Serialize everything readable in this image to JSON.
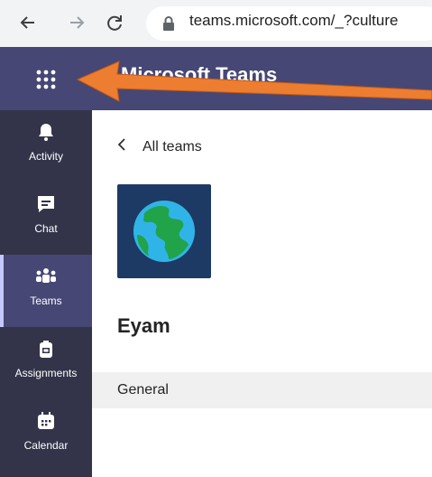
{
  "browser": {
    "url": "teams.microsoft.com/_?culture",
    "icons": [
      "back-arrow-icon",
      "forward-arrow-icon",
      "reload-icon",
      "lock-icon"
    ]
  },
  "header": {
    "app_title": "Microsoft Teams",
    "accent_color": "#464775"
  },
  "rail": {
    "items": [
      {
        "label": "Activity",
        "icon": "bell-icon"
      },
      {
        "label": "Chat",
        "icon": "chat-icon"
      },
      {
        "label": "Teams",
        "icon": "teams-icon",
        "active": true
      },
      {
        "label": "Assignments",
        "icon": "assignments-icon"
      },
      {
        "label": "Calendar",
        "icon": "calendar-icon"
      }
    ]
  },
  "main": {
    "back_label": "All teams",
    "team_name": "Eyam",
    "channels": [
      "General"
    ]
  },
  "annotation": {
    "arrow_color": "#ed7d31"
  }
}
